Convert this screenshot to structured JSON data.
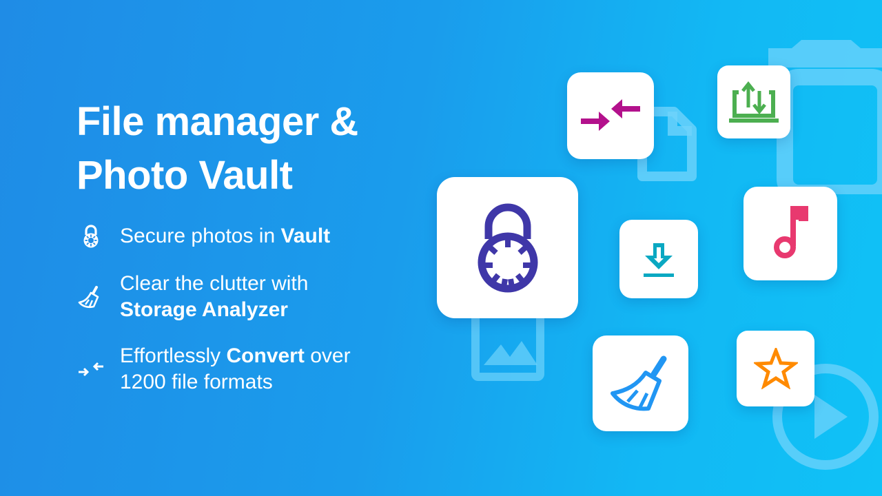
{
  "headline": {
    "line1": "File manager &",
    "line2": "Photo Vault"
  },
  "features": [
    {
      "icon": "lock-icon",
      "text_before": "Secure photos in ",
      "text_bold": "Vault",
      "text_after": ""
    },
    {
      "icon": "broom-icon",
      "line1": "Clear the clutter with",
      "line2_bold": "Storage Analyzer"
    },
    {
      "icon": "convert-arrows-icon",
      "text_before": "Effortlessly ",
      "text_bold": "Convert",
      "text_after": " over",
      "line2": "1200 file formats"
    }
  ],
  "cards": [
    {
      "name": "vault-lock",
      "icon": "combination-lock-icon",
      "color": "#3f37a8"
    },
    {
      "name": "convert",
      "icon": "convert-arrows-icon",
      "color": "#b3118c"
    },
    {
      "name": "transfer",
      "icon": "laptop-transfer-icon",
      "color": "#4caf50"
    },
    {
      "name": "download",
      "icon": "download-icon",
      "color": "#0aa8c2"
    },
    {
      "name": "music",
      "icon": "music-note-icon",
      "color": "#e8396f"
    },
    {
      "name": "cleaner",
      "icon": "broom-icon",
      "color": "#2196f3"
    },
    {
      "name": "favorites",
      "icon": "star-icon",
      "color": "#ff8a00"
    }
  ],
  "colors": {
    "bg_left": "#1f8ce6",
    "bg_right": "#10c2f6",
    "shape": "#6fd3fb"
  }
}
